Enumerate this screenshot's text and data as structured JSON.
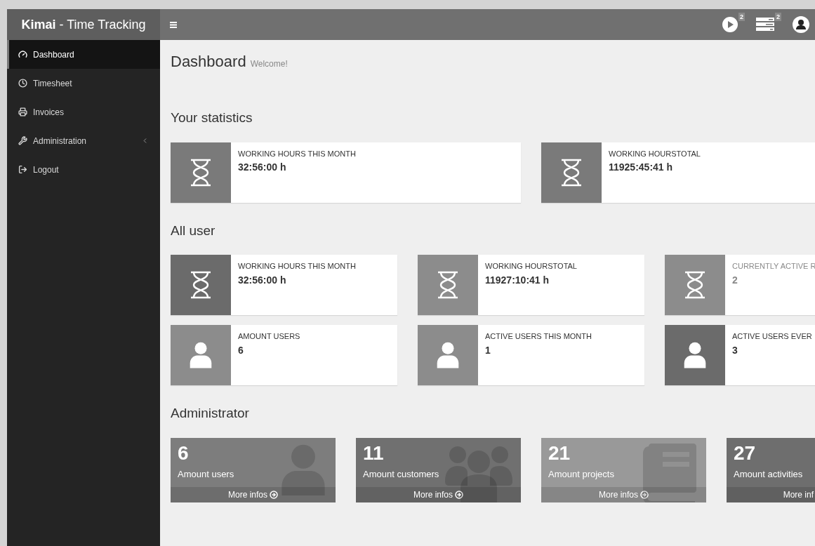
{
  "brand": {
    "bold": "Kimai",
    "rest": " - Time Tracking"
  },
  "header": {
    "badges": [
      {
        "kind": "play",
        "count": "2"
      },
      {
        "kind": "tasks",
        "count": "2"
      },
      {
        "kind": "user"
      }
    ]
  },
  "sidebar": {
    "items": [
      {
        "label": "Dashboard",
        "selected": true
      },
      {
        "label": "Timesheet",
        "selected": false
      },
      {
        "label": "Invoices",
        "selected": false
      },
      {
        "label": "Administration",
        "selected": false,
        "expandable": true
      },
      {
        "label": "Logout",
        "selected": false
      }
    ]
  },
  "page": {
    "title": "Dashboard",
    "subtitle": "Welcome!"
  },
  "sections": [
    {
      "title": "Your statistics",
      "kind": "info",
      "rows": [
        [
          {
            "label": "WORKING HOURS THIS MONTH",
            "value": "32:56:00 h",
            "kind": "hourglass",
            "color": "#7a7a7a"
          },
          {
            "label": "WORKING HOURSTOTAL",
            "value": "11925:45:41 h",
            "kind": "hourglass",
            "color": "#7a7a7a"
          }
        ]
      ]
    },
    {
      "title": "All user",
      "kind": "info",
      "rows": [
        [
          {
            "label": "WORKING HOURS THIS MONTH",
            "value": "32:56:00 h",
            "kind": "hourglass",
            "color": "#6b6b6b"
          },
          {
            "label": "WORKING HOURSTOTAL",
            "value": "11927:10:41 h",
            "kind": "hourglass",
            "color": "#8c8c8c"
          },
          {
            "label": "CURRENTLY ACTIVE R",
            "value": "2",
            "kind": "hourglass",
            "color": "#8c8c8c",
            "faded": true
          }
        ],
        [
          {
            "label": "AMOUNT USERS",
            "value": "6",
            "kind": "user",
            "color": "#8c8c8c"
          },
          {
            "label": "ACTIVE USERS THIS MONTH",
            "value": "1",
            "kind": "user",
            "color": "#8c8c8c"
          },
          {
            "label": "ACTIVE USERS EVER",
            "value": "3",
            "kind": "user",
            "color": "#6b6b6b"
          }
        ]
      ]
    },
    {
      "title": "Administrator",
      "kind": "tiles",
      "tiles": [
        {
          "value": "6",
          "label": "Amount users",
          "link": "More infos",
          "kind": "user",
          "color": "#7d7d7d"
        },
        {
          "value": "11",
          "label": "Amount customers",
          "link": "More infos",
          "kind": "group",
          "color": "#707070"
        },
        {
          "value": "21",
          "label": "Amount projects",
          "link": "More infos",
          "kind": "book",
          "color": "#999999"
        },
        {
          "value": "27",
          "label": "Amount activities",
          "link": "More inf",
          "kind": "cut",
          "color": "#6e6e6e"
        }
      ]
    }
  ]
}
